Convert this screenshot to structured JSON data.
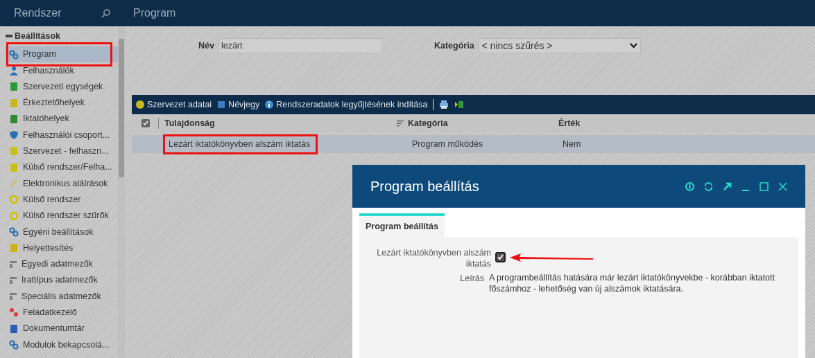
{
  "topbar": {
    "sidebar_title": "Rendszer",
    "page_title": "Program"
  },
  "sidebar": {
    "group": "Beállítások",
    "items": [
      {
        "label": "Program",
        "selected": true
      },
      {
        "label": "Felhasználók",
        "selected": false
      },
      {
        "label": "Szervezeti egységek",
        "selected": false
      },
      {
        "label": "Érkeztetőhelyek",
        "selected": false
      },
      {
        "label": "Iktatóhelyek",
        "selected": false
      },
      {
        "label": "Felhasználói csoport...",
        "selected": false
      },
      {
        "label": "Szervezet - felhaszn...",
        "selected": false
      },
      {
        "label": "Külső rendszer/Felha...",
        "selected": false
      },
      {
        "label": "Elektronikus aláírások",
        "selected": false
      },
      {
        "label": "Külső rendszer",
        "selected": false
      },
      {
        "label": "Külső rendszer szűrők",
        "selected": false
      },
      {
        "label": "Egyéni beállítások",
        "selected": false
      },
      {
        "label": "Helyettesítés",
        "selected": false
      },
      {
        "label": "Egyedi adatmezők",
        "selected": false
      },
      {
        "label": "Irattípus adatmezők",
        "selected": false
      },
      {
        "label": "Speciális adatmezők",
        "selected": false
      },
      {
        "label": "Feladatkezelő",
        "selected": false
      },
      {
        "label": "Dokumentumtár",
        "selected": false
      },
      {
        "label": "Modulok bekapcsolá...",
        "selected": false
      }
    ]
  },
  "filters": {
    "name_label": "Név",
    "name_value": "lezárt",
    "category_label": "Kategória",
    "category_value": "< nincs szűrés >"
  },
  "toolbar": [
    "Szervezet adatai",
    "Névjegy",
    "Rendszeradatok legyűjtésének indítása"
  ],
  "table": {
    "select_all_checked": true,
    "columns": [
      "Tulajdonság",
      "Kategória",
      "Érték"
    ],
    "rows": [
      {
        "cells": [
          "Lezárt iktatókönyvben alszám iktatás",
          "Program működés",
          "Nem"
        ],
        "selected": true
      }
    ]
  },
  "dialog": {
    "title": "Program beállítás",
    "tabs": [
      {
        "label": "Program beállítás",
        "selected": true
      }
    ],
    "setting_label": "Lezárt iktatókönyvben alszám iktatás",
    "setting_checked": true,
    "description_label": "Leírás",
    "description": "A programbeállítás hatására már lezárt iktatókönyvekbe - korábban iktatott főszámhoz - lehetőség van új alszámok iktatására."
  }
}
